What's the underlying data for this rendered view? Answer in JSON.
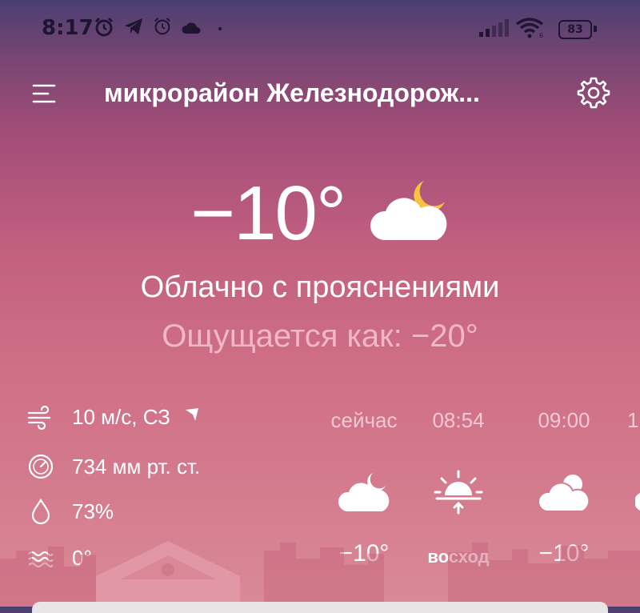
{
  "status_bar": {
    "time": "8:17",
    "battery": "83"
  },
  "header": {
    "title": "микрорайон Железнодорож..."
  },
  "current": {
    "temperature": "−10°",
    "condition": "Облачно с прояснениями",
    "feels_like": "Ощущается как: −20°"
  },
  "details": {
    "wind": "10 м/с, СЗ",
    "pressure": "734 мм рт. ст.",
    "humidity": "73%",
    "water_temp": "0°"
  },
  "hourly": [
    {
      "label": "сейчас",
      "icon": "partly-cloudy-night-icon",
      "value": "−10°"
    },
    {
      "label": "08:54",
      "icon": "sunrise-icon",
      "value": "восход"
    },
    {
      "label": "09:00",
      "icon": "partly-cloudy-icon",
      "value": "−10°"
    },
    {
      "label": "1",
      "icon": "partly-cloudy-icon",
      "value": ""
    }
  ],
  "icons": {
    "menu": "menu-icon",
    "settings": "gear-icon",
    "wind": "wind-icon",
    "pressure": "pressure-gauge-icon",
    "humidity": "droplet-icon",
    "water": "water-waves-icon"
  }
}
